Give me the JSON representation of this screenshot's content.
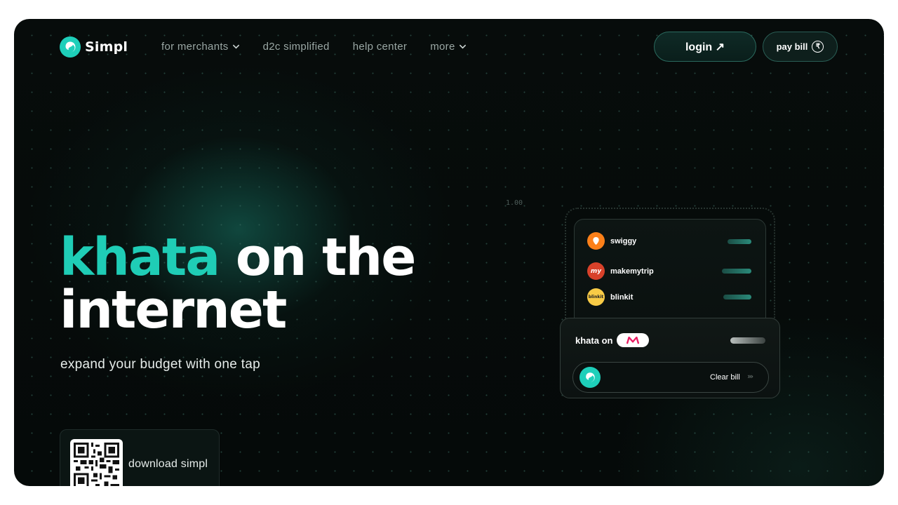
{
  "brand": {
    "name": "Simpl",
    "accent": "#1ecfba"
  },
  "nav": {
    "items": [
      {
        "label": "for merchants",
        "has_dropdown": true
      },
      {
        "label": "d2c simplified",
        "has_dropdown": false
      },
      {
        "label": "help center",
        "has_dropdown": false
      },
      {
        "label": "more",
        "has_dropdown": true
      }
    ]
  },
  "header": {
    "login_label": "login ↗",
    "pay_bill_label": "pay bill",
    "rupee_symbol": "₹"
  },
  "hero": {
    "title_accent": "khata",
    "title_rest_line1": " on the",
    "title_line2": "internet",
    "subtitle": "expand your budget with one tap"
  },
  "download": {
    "label": "download simpl"
  },
  "axis_label": "1.00",
  "merchants": [
    {
      "name": "swiggy",
      "icon": "swiggy-icon",
      "color": "#fc8019"
    },
    {
      "name": "makemytrip",
      "icon": "makemytrip-icon",
      "color": "#e8472e"
    },
    {
      "name": "blinkit",
      "icon": "blinkit-icon",
      "color": "#f8cb46",
      "icon_text": "blinkit"
    }
  ],
  "khata": {
    "label": "khata on",
    "partner_icon": "myntra-icon",
    "clear_label": "Clear bill",
    "arrows": "›››"
  }
}
